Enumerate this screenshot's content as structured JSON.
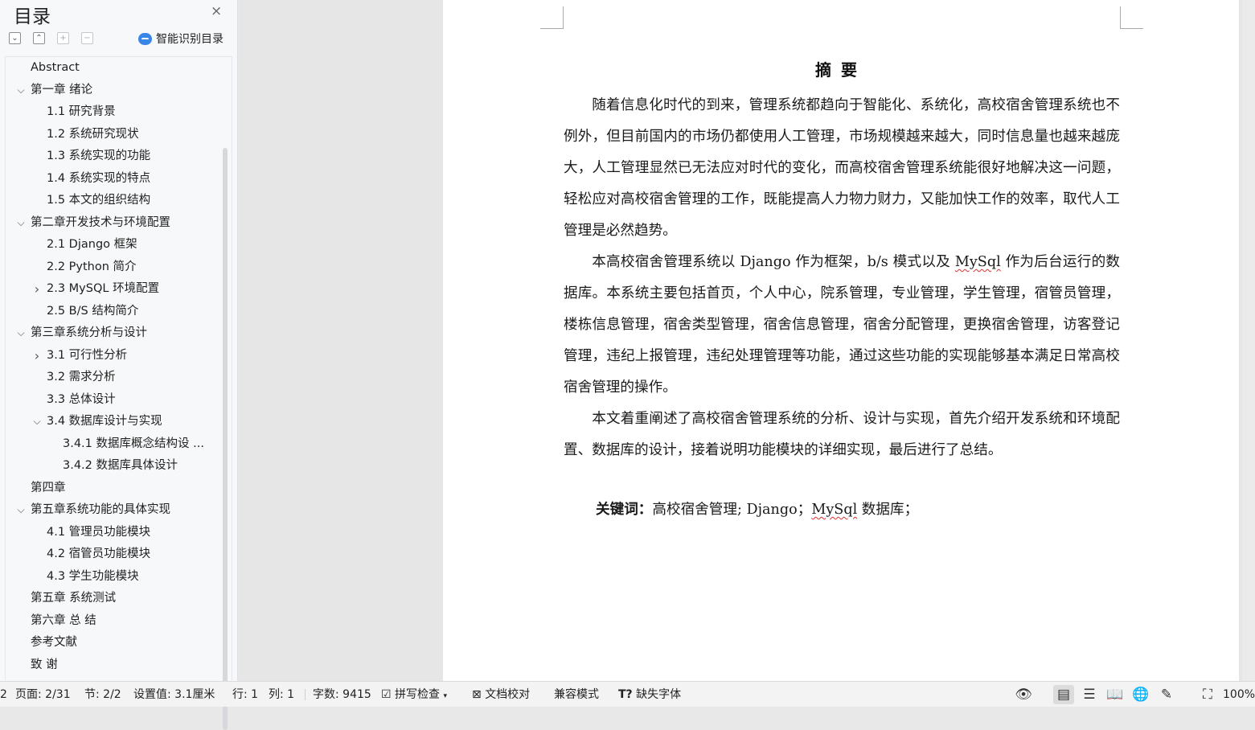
{
  "toc": {
    "title": "目录",
    "close_symbol": "×",
    "smart_label": "智能识别目录",
    "items": [
      {
        "label": "Abstract",
        "level": 0,
        "chevron": ""
      },
      {
        "label": "第一章  绪论",
        "level": 0,
        "chevron": "down"
      },
      {
        "label": "1.1 研究背景",
        "level": 1,
        "chevron": ""
      },
      {
        "label": "1.2 系统研究现状",
        "level": 1,
        "chevron": ""
      },
      {
        "label": "1.3 系统实现的功能",
        "level": 1,
        "chevron": ""
      },
      {
        "label": "1.4 系统实现的特点",
        "level": 1,
        "chevron": ""
      },
      {
        "label": "1.5 本文的组织结构",
        "level": 1,
        "chevron": ""
      },
      {
        "label": "第二章开发技术与环境配置",
        "level": 0,
        "chevron": "down"
      },
      {
        "label": "2.1 Django 框架",
        "level": 1,
        "chevron": ""
      },
      {
        "label": "2.2 Python 简介",
        "level": 1,
        "chevron": ""
      },
      {
        "label": "2.3 MySQL 环境配置",
        "level": 1,
        "chevron": "right"
      },
      {
        "label": "2.5 B/S 结构简介",
        "level": 1,
        "chevron": ""
      },
      {
        "label": "第三章系统分析与设计",
        "level": 0,
        "chevron": "down"
      },
      {
        "label": "3.1  可行性分析",
        "level": 1,
        "chevron": "right"
      },
      {
        "label": "3.2  需求分析",
        "level": 1,
        "chevron": ""
      },
      {
        "label": "3.3 总体设计",
        "level": 1,
        "chevron": ""
      },
      {
        "label": "3.4  数据库设计与实现",
        "level": 1,
        "chevron": "down"
      },
      {
        "label": "3.4.1 数据库概念结构设 ...",
        "level": 2,
        "chevron": ""
      },
      {
        "label": "3.4.2 数据库具体设计",
        "level": 2,
        "chevron": ""
      },
      {
        "label": "第四章",
        "level": 0,
        "chevron": ""
      },
      {
        "label": "第五章系统功能的具体实现",
        "level": 0,
        "chevron": "down"
      },
      {
        "label": "4.1 管理员功能模块",
        "level": 1,
        "chevron": ""
      },
      {
        "label": "4.2 宿管员功能模块",
        "level": 1,
        "chevron": ""
      },
      {
        "label": "4.3 学生功能模块",
        "level": 1,
        "chevron": ""
      },
      {
        "label": "第五章  系统测试",
        "level": 0,
        "chevron": ""
      },
      {
        "label": "第六章  总  结",
        "level": 0,
        "chevron": ""
      },
      {
        "label": "参考文献",
        "level": 0,
        "chevron": ""
      },
      {
        "label": "致  谢",
        "level": 0,
        "chevron": ""
      }
    ]
  },
  "document": {
    "title": "摘要",
    "para1": "随着信息化时代的到来，管理系统都趋向于智能化、系统化，高校宿舍管理系统也不例外，但目前国内的市场仍都使用人工管理，市场规模越来越大，同时信息量也越来越庞大，人工管理显然已无法应对时代的变化，而高校宿舍管理系统能很好地解决这一问题，轻松应对高校宿舍管理的工作，既能提高人力物力财力，又能加快工作的效率，取代人工管理是必然趋势。",
    "para2_a": "本高校宿舍管理系统以 Django 作为框架，b/s 模式以及 ",
    "para2_mysql": "MySql",
    "para2_b": " 作为后台运行的数据库。本系统主要包括首页，个人中心，院系管理，专业管理，学生管理，宿管员管理，楼栋信息管理，宿舍类型管理，宿舍信息管理，宿舍分配管理，更换宿舍管理，访客登记管理，违纪上报管理，违纪处理管理等功能，通过这些功能的实现能够基本满足日常高校宿舍管理的操作。",
    "para3": "本文着重阐述了高校宿舍管理系统的分析、设计与实现，首先介绍开发系统和环境配置、数据库的设计，接着说明功能模块的详细实现，最后进行了总结。",
    "keywords_label": "关键词：",
    "keywords_a": "高校宿舍管理; Django；",
    "keywords_mysql": "MySql",
    "keywords_b": " 数据库；"
  },
  "statusbar": {
    "left_edge": "2",
    "page": "页面: 2/31",
    "section": "节: 2/2",
    "setting": "设置值: 3.1厘米",
    "line": "行: 1",
    "column": "列: 1",
    "word_count": "字数: 9415",
    "spell_check": "拼写检查",
    "doc_proof": "文档校对",
    "compat_mode": "兼容模式",
    "missing_font": "缺失字体",
    "zoom": "100%"
  }
}
